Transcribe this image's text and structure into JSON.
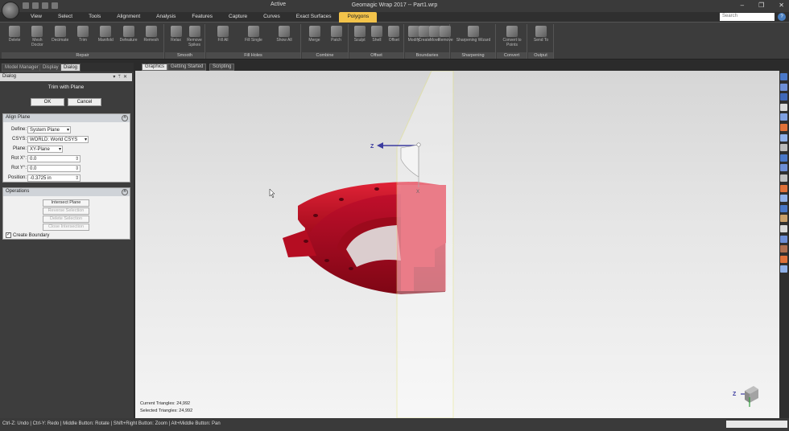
{
  "window": {
    "title": "Geomagic Wrap 2017 -- Part1.wrp",
    "context_tab_label": "Active"
  },
  "menu": {
    "tabs": [
      "View",
      "Select",
      "Tools",
      "Alignment",
      "Analysis",
      "Features",
      "Capture",
      "Curves",
      "Exact Surfaces",
      "Polygons"
    ],
    "active_tab": "Polygons",
    "search_placeholder": "Search"
  },
  "ribbon": {
    "groups": [
      {
        "label": "Repair",
        "buttons": [
          "Delete",
          "Mesh Doctor",
          "Decimate",
          "Trim",
          "Manifold",
          "Defeature",
          "Remesh"
        ]
      },
      {
        "label": "Smooth",
        "buttons": [
          "Relax",
          "Remove Spikes"
        ]
      },
      {
        "label": "Fill Holes",
        "buttons": [
          "Fill All",
          "Fill Single",
          "Show All"
        ]
      },
      {
        "label": "Combine",
        "buttons": [
          "Merge",
          "Patch"
        ]
      },
      {
        "label": "Offset",
        "buttons": [
          "Sculpt",
          "Shell",
          "Offset"
        ]
      },
      {
        "label": "Boundaries",
        "buttons": [
          "Modify",
          "Create",
          "Move",
          "Remove"
        ]
      },
      {
        "label": "Sharpening",
        "buttons": [
          "Sharpening Wizard"
        ]
      },
      {
        "label": "Convert",
        "buttons": [
          "Convert to Points"
        ]
      },
      {
        "label": "Output",
        "buttons": [
          "Send To"
        ]
      }
    ]
  },
  "panel_tabs": [
    "Model Manager",
    "Display",
    "Dialog"
  ],
  "panel_active_tab": "Dialog",
  "dialog": {
    "header": "Dialog",
    "title": "Trim with Plane",
    "ok_label": "OK",
    "cancel_label": "Cancel",
    "align_plane": {
      "heading": "Align Plane",
      "define_label": "Define:",
      "define_value": "System Plane",
      "csys_label": "CSYS:",
      "csys_value": "WORLD: World CSYS",
      "plane_label": "Plane:",
      "plane_value": "XY-Plane",
      "rotx_label": "Rot X°:",
      "rotx_value": "0.0",
      "roty_label": "Rot Y°:",
      "roty_value": "0.0",
      "position_label": "Position:",
      "position_value": "-0.3725 in"
    },
    "operations": {
      "heading": "Operations",
      "buttons": [
        "Intersect Plane",
        "Reverse Selection",
        "Delete Selection",
        "Close Intersection"
      ],
      "create_boundary_label": "Create Boundary",
      "create_boundary_checked": true
    }
  },
  "view_tabs": [
    "Graphics",
    "Getting Started",
    "Scripting"
  ],
  "view_active_tab": "Graphics",
  "viewport": {
    "current_triangles_label": "Current Triangles: 24,992",
    "selected_triangles_label": "Selected Triangles: 24,992",
    "axis_z_label": "Z",
    "axis_x_label": "X",
    "triad_z_label": "Z",
    "model_color": "#c8102e",
    "plane_color": "#f0f0a0"
  },
  "status": {
    "hint": "Ctrl-Z: Undo | Ctrl-Y: Redo | Middle Button: Rotate | Shift+Right Button: Zoom | Alt+Middle Button: Pan"
  }
}
